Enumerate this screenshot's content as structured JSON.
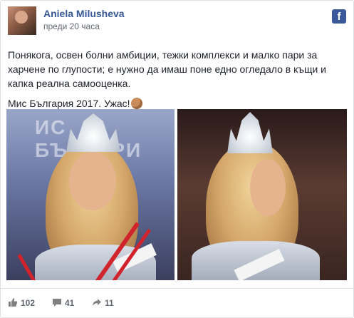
{
  "post": {
    "author": "Aniela Milusheva",
    "time": "преди 20 часа",
    "paragraph1": "Понякога, освен болни амбиции, тежки комплекси и малко пари за харчене по глупости; е нужно да имаш поне едно огледало в къщи и капка реална самооценка.",
    "paragraph2": "Мис България 2017. Ужас!"
  },
  "footer": {
    "likes": "102",
    "comments": "41",
    "shares": "11"
  },
  "icons": {
    "network": "facebook-icon",
    "like": "thumbs-up-icon",
    "comment": "comment-icon",
    "share": "share-arrow-icon",
    "emoji": "monkey-face-emoji"
  },
  "colors": {
    "author_link": "#365899",
    "facebook_blue": "#3b5998",
    "meta_text": "#616770"
  }
}
